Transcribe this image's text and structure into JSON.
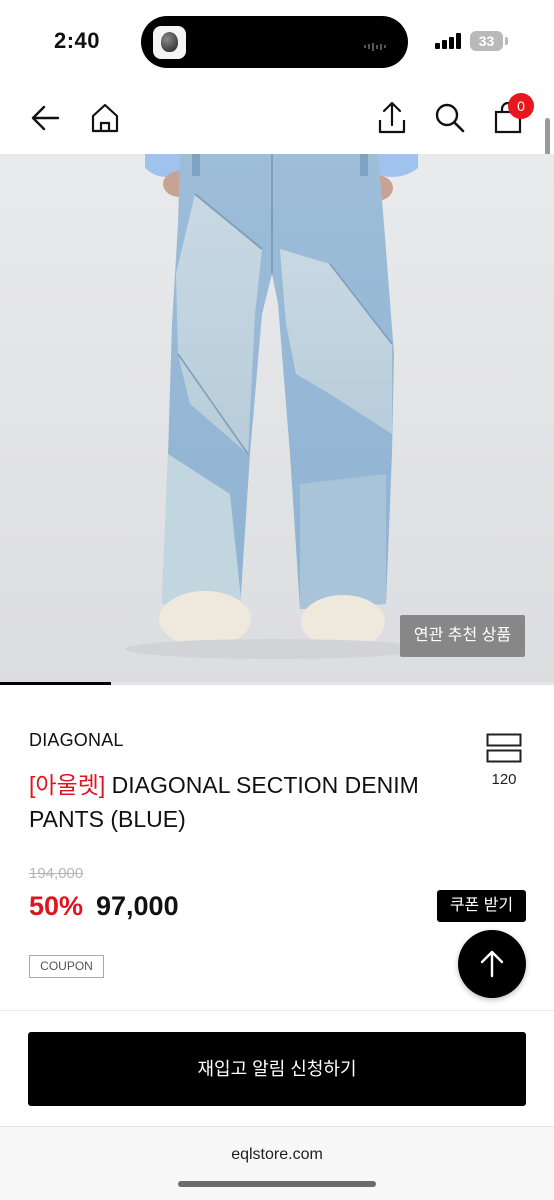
{
  "status_bar": {
    "time": "2:40",
    "battery": "33"
  },
  "nav": {
    "cart_count": "0"
  },
  "hero": {
    "related_label": "연관 추천 상품",
    "gallery_progress": 0.2
  },
  "product": {
    "brand": "DIAGONAL",
    "tag": "[아울렛]",
    "name": " DIAGONAL SECTION DENIM PANTS (BLUE)",
    "like_count": "120",
    "original_price": "194,000",
    "discount": "50%",
    "price": "97,000",
    "coupon_button": "쿠폰 받기",
    "coupon_tag": "COUPON"
  },
  "actions": {
    "restock_label": "재입고 알림 신청하기"
  },
  "browser": {
    "url": "eqlstore.com"
  },
  "colors": {
    "accent_red": "#e0141e",
    "black": "#000000"
  }
}
